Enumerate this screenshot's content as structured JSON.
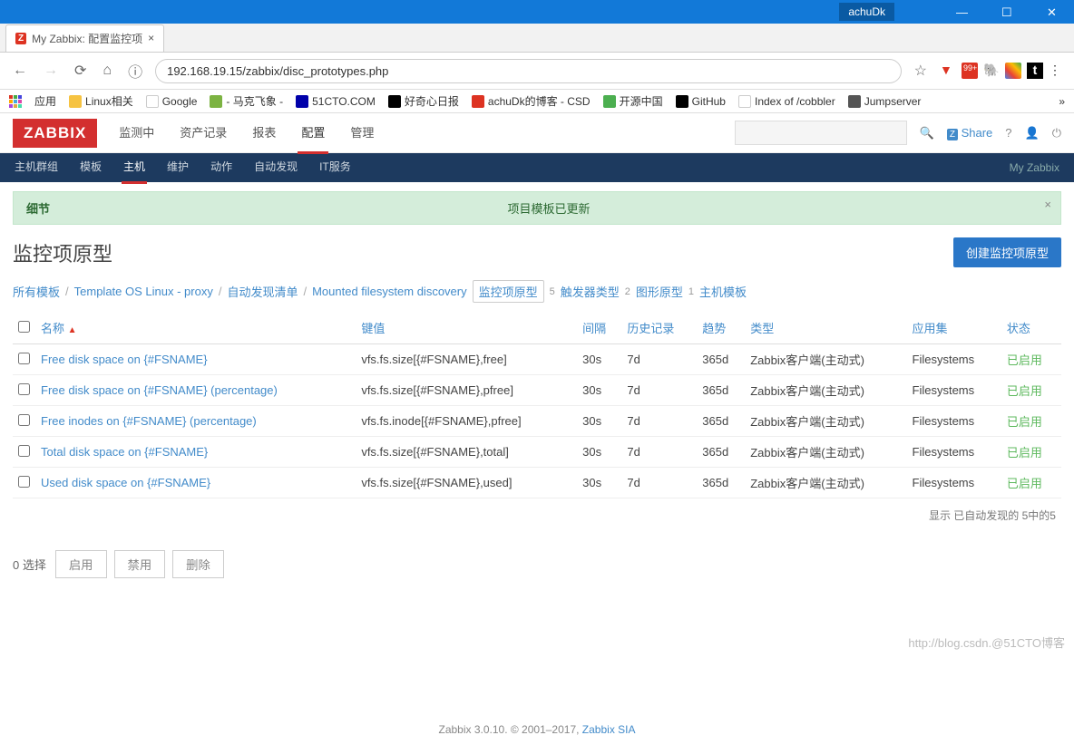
{
  "window": {
    "user": "achuDk"
  },
  "browser": {
    "tab_title": "My Zabbix: 配置监控项",
    "url": "192.168.19.15/zabbix/disc_prototypes.php",
    "bookmarks_label": "应用",
    "bookmarks": [
      {
        "label": "Linux相关",
        "color": "#f6c342"
      },
      {
        "label": "Google",
        "color": ""
      },
      {
        "label": "- 马克飞象 -",
        "color": "#7cb342"
      },
      {
        "label": "51CTO.COM",
        "color": "#00a"
      },
      {
        "label": "好奇心日报",
        "color": "#000"
      },
      {
        "label": "achuDk的博客 - CSD",
        "color": "#d32"
      },
      {
        "label": "开源中国",
        "color": "#4caf50"
      },
      {
        "label": "GitHub",
        "color": "#000"
      },
      {
        "label": "Index of /cobbler",
        "color": ""
      },
      {
        "label": "Jumpserver",
        "color": "#555"
      }
    ]
  },
  "zabbix": {
    "logo": "ZABBIX",
    "top_nav": [
      "监测中",
      "资产记录",
      "报表",
      "配置",
      "管理"
    ],
    "top_nav_active": 3,
    "share_label": "Share",
    "sub_nav": [
      "主机群组",
      "模板",
      "主机",
      "维护",
      "动作",
      "自动发现",
      "IT服务"
    ],
    "sub_nav_active": 2,
    "sub_nav_right": "My Zabbix"
  },
  "alert": {
    "title": "细节",
    "message": "项目模板已更新"
  },
  "page": {
    "title": "监控项原型",
    "create_button": "创建监控项原型"
  },
  "breadcrumb": {
    "items": [
      {
        "label": "所有模板",
        "type": "link"
      },
      {
        "label": "Template OS Linux - proxy",
        "type": "link"
      },
      {
        "label": "自动发现清单",
        "type": "link"
      },
      {
        "label": "Mounted filesystem discovery",
        "type": "link"
      },
      {
        "label": "监控项原型",
        "count": "5",
        "type": "pill"
      },
      {
        "label": "触发器类型",
        "count": "2",
        "type": "link"
      },
      {
        "label": "图形原型",
        "count": "1",
        "type": "link"
      },
      {
        "label": "主机模板",
        "type": "link"
      }
    ]
  },
  "table": {
    "headers": [
      "名称",
      "键值",
      "间隔",
      "历史记录",
      "趋势",
      "类型",
      "应用集",
      "状态"
    ],
    "sorted_col": 0,
    "rows": [
      {
        "name": "Free disk space on {#FSNAME}",
        "key": "vfs.fs.size[{#FSNAME},free]",
        "interval": "30s",
        "history": "7d",
        "trends": "365d",
        "type": "Zabbix客户端(主动式)",
        "apps": "Filesystems",
        "status": "已启用"
      },
      {
        "name": "Free disk space on {#FSNAME} (percentage)",
        "key": "vfs.fs.size[{#FSNAME},pfree]",
        "interval": "30s",
        "history": "7d",
        "trends": "365d",
        "type": "Zabbix客户端(主动式)",
        "apps": "Filesystems",
        "status": "已启用"
      },
      {
        "name": "Free inodes on {#FSNAME} (percentage)",
        "key": "vfs.fs.inode[{#FSNAME},pfree]",
        "interval": "30s",
        "history": "7d",
        "trends": "365d",
        "type": "Zabbix客户端(主动式)",
        "apps": "Filesystems",
        "status": "已启用"
      },
      {
        "name": "Total disk space on {#FSNAME}",
        "key": "vfs.fs.size[{#FSNAME},total]",
        "interval": "30s",
        "history": "7d",
        "trends": "365d",
        "type": "Zabbix客户端(主动式)",
        "apps": "Filesystems",
        "status": "已启用"
      },
      {
        "name": "Used disk space on {#FSNAME}",
        "key": "vfs.fs.size[{#FSNAME},used]",
        "interval": "30s",
        "history": "7d",
        "trends": "365d",
        "type": "Zabbix客户端(主动式)",
        "apps": "Filesystems",
        "status": "已启用"
      }
    ],
    "footer": "显示 已自动发现的 5中的5"
  },
  "bulk": {
    "selected": "0 选择",
    "buttons": [
      "启用",
      "禁用",
      "删除"
    ]
  },
  "footer": {
    "text_pre": "Zabbix 3.0.10. © 2001–2017, ",
    "link": "Zabbix SIA"
  },
  "watermark": "http://blog.csdn.@51CTO博客"
}
